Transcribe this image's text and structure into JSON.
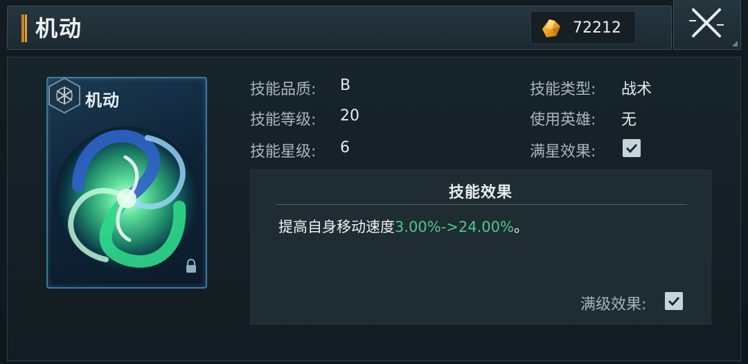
{
  "window": {
    "title": "机动"
  },
  "currency": {
    "icon": "gold-crystal-icon",
    "value": "72212"
  },
  "close": {
    "icon": "close-swords-icon"
  },
  "card": {
    "name": "机动",
    "emblem_icon": "hexagon-snowflake-icon",
    "art": "green-blue-vortex",
    "lock_icon": "lock-icon"
  },
  "info": {
    "quality_label": "技能品质:",
    "quality_value": "B",
    "level_label": "技能等级:",
    "level_value": "20",
    "star_label": "技能星级:",
    "star_value": "6",
    "type_label": "技能类型:",
    "type_value": "战术",
    "hero_label": "使用英雄:",
    "hero_value": "无",
    "fullstar_label": "满星效果:",
    "fullstar_checked": true
  },
  "effect": {
    "title": "技能效果",
    "text_prefix": "提高自身移动速度",
    "text_highlight": "3.00%->24.00%",
    "text_suffix": "。",
    "maxlevel_label": "满级效果:",
    "maxlevel_checked": true
  },
  "colors": {
    "highlight": "#4fc98a",
    "accent_gold": "#e0a030",
    "card_border": "#3d7aa0"
  }
}
